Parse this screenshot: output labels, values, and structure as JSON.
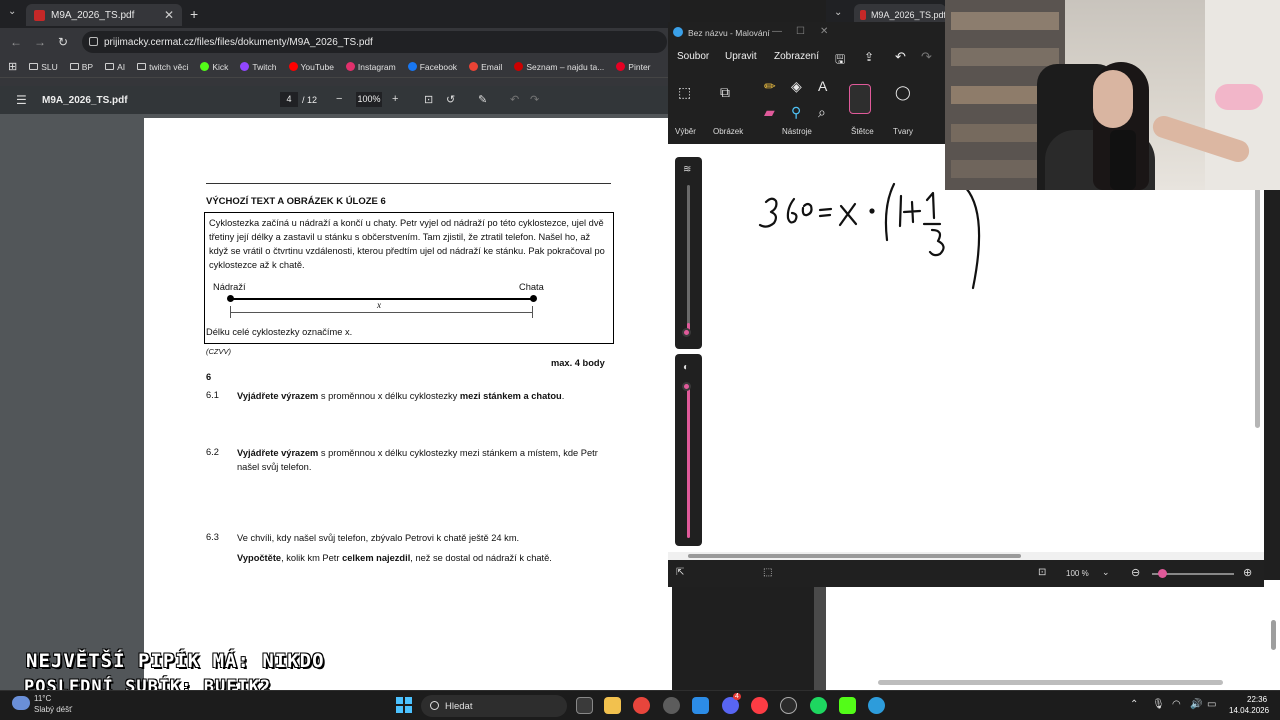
{
  "browser": {
    "tab_title": "M9A_2026_TS.pdf",
    "url": "prijimacky.cermat.cz/files/files/dokumenty/M9A_2026_TS.pdf",
    "bookmarks": [
      "SLU",
      "BP",
      "AI",
      "twitch věci",
      "Kick",
      "Twitch",
      "YouTube",
      "Instagram",
      "Facebook",
      "Email",
      "Seznam – najdu ta...",
      "Pinter"
    ],
    "bookmark_colors": [
      "#cfcfcf",
      "#cfcfcf",
      "#cfcfcf",
      "#cfcfcf",
      "#53fc18",
      "#9146ff",
      "#ff0000",
      "#e1306c",
      "#1877f2",
      "#ea4335",
      "#cc0000",
      "#e60023"
    ]
  },
  "pdf": {
    "title": "M9A_2026_TS.pdf",
    "page_current": "4",
    "page_total": "/ 12",
    "zoom": "100%",
    "heading": "VÝCHOZÍ TEXT A OBRÁZEK K ÚLOZE 6",
    "box_text": "Cyklostezka začíná u nádraží a končí u chaty. Petr vyjel od nádraží po této cyklostezce, ujel dvě třetiny její délky a zastavil u stánku s občerstvením. Tam zjistil, že ztratil telefon. Našel ho, až když se vrátil o čtvrtinu vzdálenosti, kterou předtím ujel od nádraží ke stánku. Pak pokračoval po cyklostezce až k chatě.",
    "label_start": "Nádraží",
    "label_end": "Chata",
    "label_x": "x",
    "box_footer": "Délku celé cyklostezky označíme x.",
    "source": "(CZVV)",
    "max_points": "max. 4 body",
    "question_number": "6",
    "questions": [
      {
        "no": "6.1",
        "bold": "Vyjádřete výrazem",
        "text": " s proměnnou x délku cyklostezky ",
        "bold2": "mezi stánkem a chatou",
        "tail": "."
      },
      {
        "no": "6.2",
        "bold": "Vyjádřete výrazem",
        "text": " s proměnnou x délku cyklostezky mezi stánkem a místem, kde Petr našel svůj telefon."
      },
      {
        "no": "6.3",
        "text": "Ve chvíli, kdy našel svůj telefon, zbývalo Petrovi k chatě ještě 24 km.",
        "bold": "Vypočtěte",
        "text2": ", kolik km Petr ",
        "bold2": "celkem najezdil",
        "tail": ", než se dostal od nádraží k chatě."
      }
    ]
  },
  "right_browser": {
    "tab_title": "M9A_2026_TS.pdf"
  },
  "paint": {
    "title": "Bez názvu - Malování",
    "menus": [
      "Soubor",
      "Upravit",
      "Zobrazení"
    ],
    "tool_groups": [
      "Výběr",
      "Obrázek",
      "Nástroje",
      "Štětce",
      "Tvary"
    ],
    "zoom": "100 %",
    "handwriting": "360 = x · (1 + 1/3)"
  },
  "overlay": {
    "line1": "NEJVĚTŠÍ PIPÍK MÁ: NIKDO",
    "line2": "POSLEDNÍ SUBÍK: BUFIK2"
  },
  "taskbar": {
    "temperature": "11°C",
    "weather": "Slabý déšť",
    "search": "Hledat",
    "time": "22:36",
    "date": "14.04.2026",
    "discord_badge": "4"
  }
}
